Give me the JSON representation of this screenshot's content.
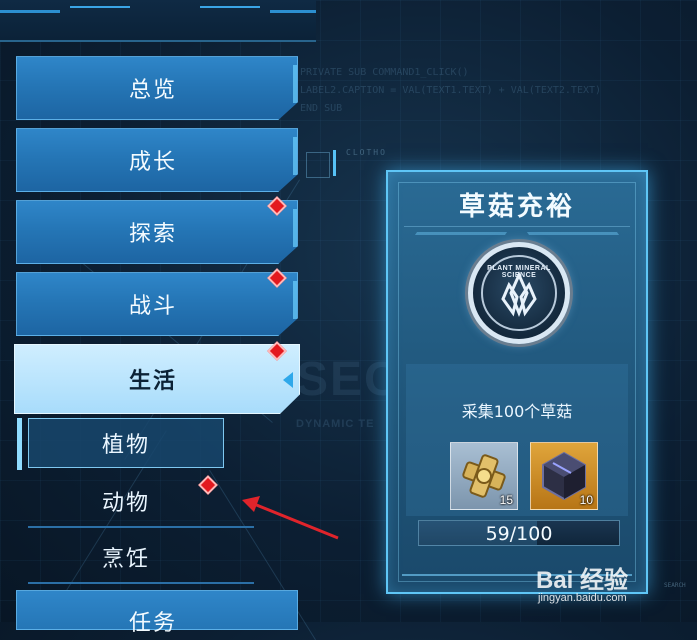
{
  "background": {
    "code_lines": [
      "PRIVATE SUB COMMAND1_CLICK()",
      "LABEL2.CAPTION = VAL(TEXT1.TEXT) + VAL(TEXT2.TEXT)",
      "END SUB"
    ],
    "big_text": "SEC",
    "small_text": "DYNAMIC TE",
    "sys_label": "CLOTHO",
    "search_label": "SEARCH"
  },
  "menu": {
    "items": [
      {
        "label": "总览",
        "has_alert": false,
        "active": false
      },
      {
        "label": "成长",
        "has_alert": false,
        "active": false
      },
      {
        "label": "探索",
        "has_alert": true,
        "active": false
      },
      {
        "label": "战斗",
        "has_alert": true,
        "active": false
      },
      {
        "label": "生活",
        "has_alert": true,
        "active": true
      }
    ],
    "sub_items": [
      {
        "label": "植物",
        "selected": true,
        "has_alert": false
      },
      {
        "label": "动物",
        "selected": false,
        "has_alert": true
      },
      {
        "label": "烹饪",
        "selected": false,
        "has_alert": false
      }
    ],
    "bottom_item": {
      "label": "任务"
    }
  },
  "achievement": {
    "title": "草菇充裕",
    "badge_text": "PLANT MINERAL SCIENCE",
    "description": "采集100个草菇",
    "rewards": [
      {
        "icon": "gold-gear-material-icon",
        "count": "15"
      },
      {
        "icon": "dark-crystal-cube-icon",
        "count": "10"
      }
    ],
    "progress": {
      "text": "59/100",
      "value": 59,
      "max": 100
    }
  },
  "watermark": {
    "main": "Bai 经验",
    "sub": "jingyan.baidu.com"
  },
  "colors": {
    "menu_blue": "#2576b6",
    "menu_active": "#a8dcfb",
    "alert_red": "#e3191f",
    "card_glow": "#5fc6f6",
    "reward_silver": "#a9bfd3",
    "reward_gold": "#e0a53b",
    "arrow_red": "#e0242b"
  }
}
